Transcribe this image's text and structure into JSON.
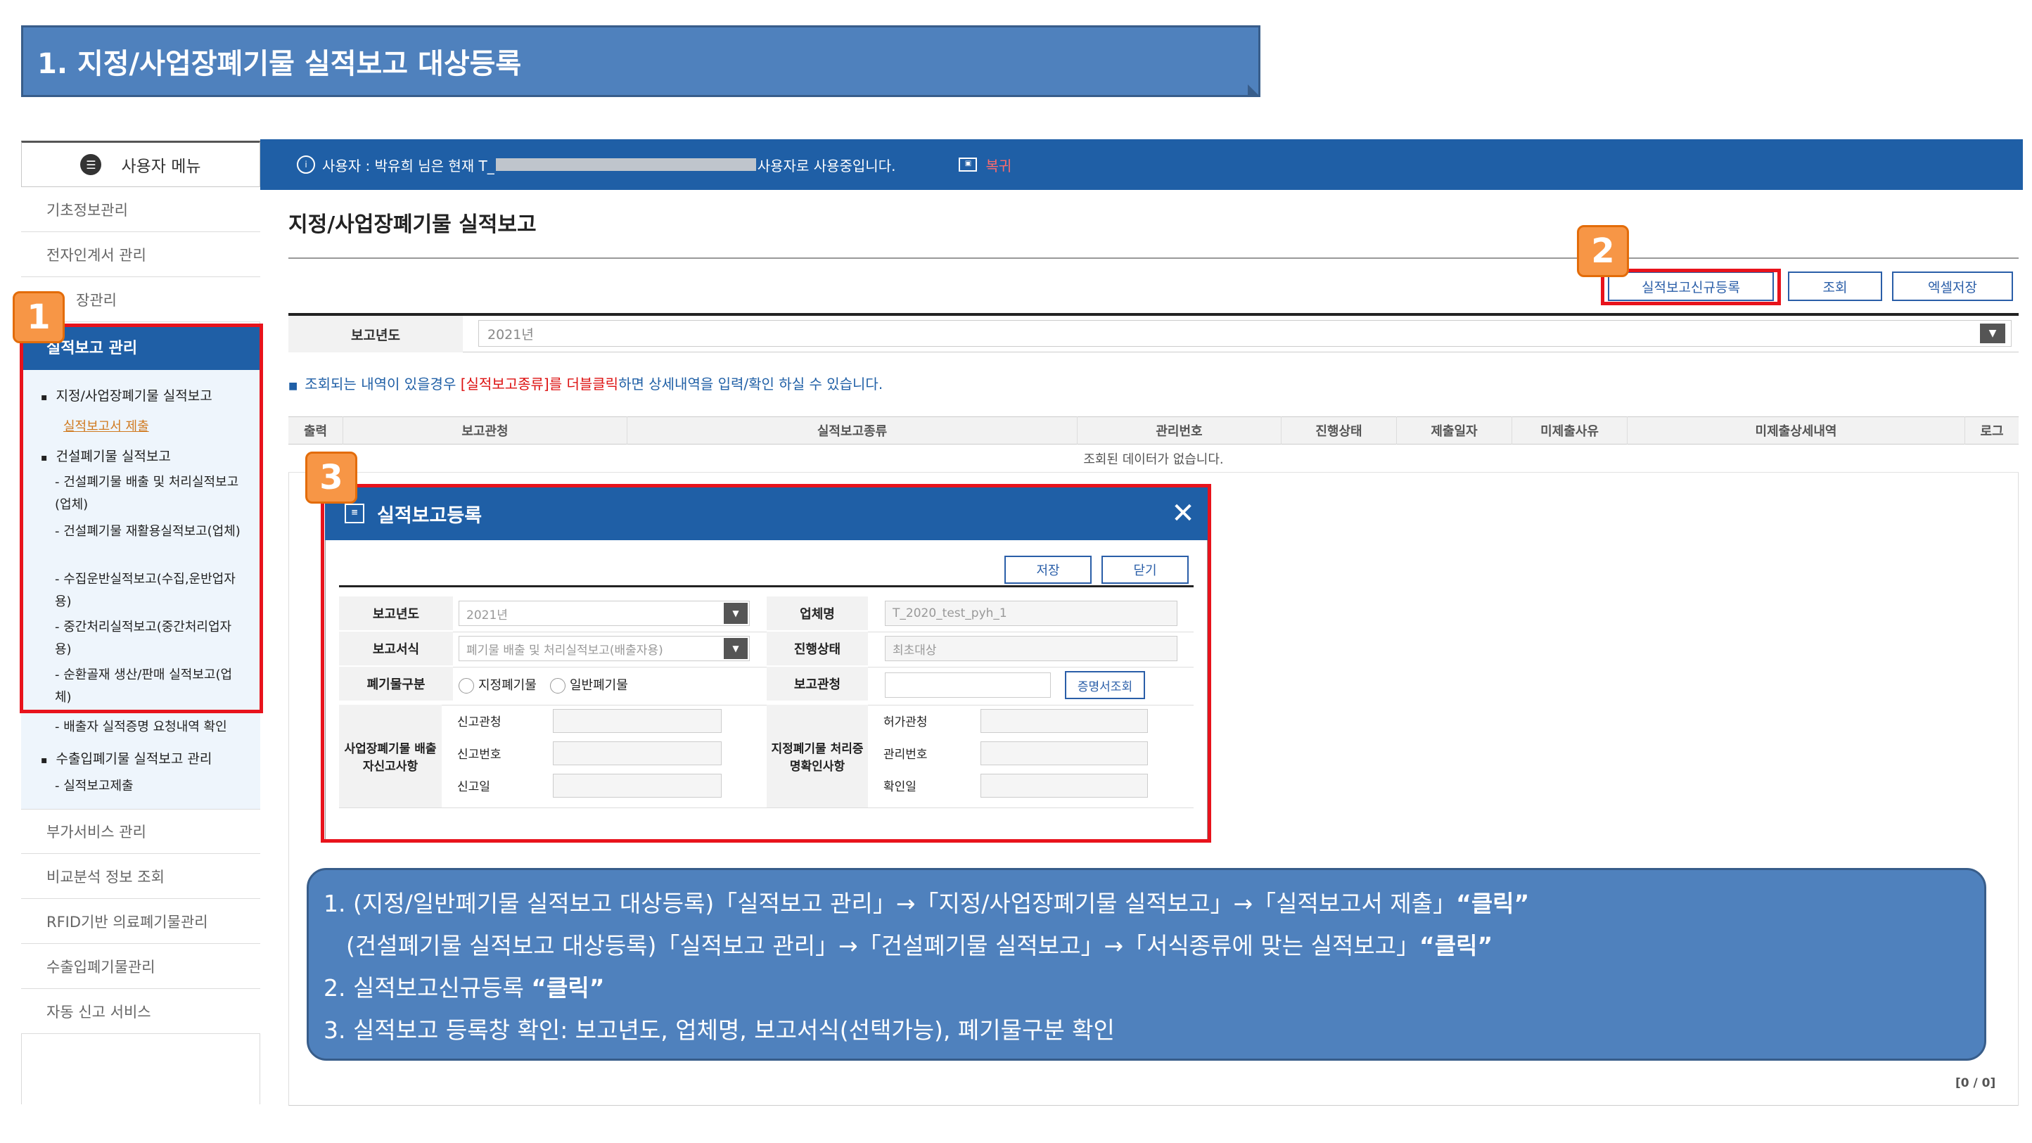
{
  "slide_title": "1. 지정/사업장폐기물 실적보고 대상등록",
  "topbar": {
    "user_prefix": "사용자 : 박유희 님은 현재 T_",
    "user_suffix": "사용자로 사용중입니다.",
    "restore_label": "복귀"
  },
  "sidebar": {
    "header": "사용자 메뉴",
    "items_top": [
      "기초정보관리",
      "전자인계서 관리",
      "장관리"
    ],
    "active": "실적보고 관리",
    "sub": {
      "designated": "지정/사업장폐기물 실적보고",
      "submit_link": "실적보고서 제출",
      "construction": "건설폐기물 실적보고",
      "c1": "- 건설폐기물 배출 및 처리실적보고(업체)",
      "c2": "- 건설폐기물 재활용실적보고(업체)",
      "c3": "- 수집운반실적보고(수집,운반업자용)",
      "c4": "- 중간처리실적보고(중간처리업자용)",
      "c5": "- 순환골재 생산/판매 실적보고(업체)",
      "c6": "- 배출자 실적증명 요청내역 확인",
      "import": "수출입폐기물 실적보고 관리",
      "i1": "- 실적보고제출"
    },
    "items_bottom": [
      "부가서비스 관리",
      "비교분석 정보 조회",
      "RFID기반 의료폐기물관리",
      "수출입폐기물관리",
      "자동 신고 서비스"
    ]
  },
  "main": {
    "title": "지정/사업장폐기물 실적보고",
    "buttons": {
      "new": "실적보고신규등록",
      "search": "조회",
      "excel": "엑셀저장"
    },
    "search_label": "보고년도",
    "year_value": "2021년",
    "notice_a": "조회되는 내역이 있을경우 ",
    "notice_red": "[실적보고종류]를 더블클릭",
    "notice_b": "하면 상세내역을 입력/확인 하실 수 있습니다.",
    "grid_headers": [
      "출력",
      "보고관청",
      "실적보고종류",
      "관리번호",
      "진행상태",
      "제출일자",
      "미제출사유",
      "미제출상세내역",
      "로그"
    ],
    "grid_empty": "조회된 데이터가 없습니다.",
    "pager": "[0 / 0]"
  },
  "modal": {
    "title": "실적보고등록",
    "save": "저장",
    "close": "닫기",
    "labels": {
      "year": "보고년도",
      "company": "업체명",
      "form": "보고서식",
      "status": "진행상태",
      "waste_type": "폐기물구분",
      "office": "보고관청",
      "emitter": "사업장폐기물 배출자신고사항",
      "handler": "지정폐기물 처리증명확인사항"
    },
    "year_value": "2021년",
    "company_value": "T_2020_test_pyh_1",
    "form_value": "폐기물 배출 및 처리실적보고(배출자용)",
    "status_value": "최초대상",
    "radio_designated": "지정폐기물",
    "radio_general": "일반폐기물",
    "cert_button": "증명서조회",
    "emitter_fields": [
      "신고관청",
      "신고번호",
      "신고일"
    ],
    "handler_fields": [
      "허가관청",
      "관리번호",
      "확인일"
    ]
  },
  "badges": [
    "1",
    "2",
    "3"
  ],
  "callout": {
    "line1_a": "1. (지정/일반폐기물 실적보고 대상등록)「실적보고 관리」→「지정/사업장폐기물 실적보고」→「실적보고서 제출」",
    "line1_b": "“클릭”",
    "line2_a": "(건설폐기물 실적보고 대상등록)「실적보고 관리」→「건설폐기물 실적보고」→「서식종류에 맞는 실적보고」",
    "line2_b": "“클릭”",
    "line3_a": "2. 실적보고신규등록 ",
    "line3_b": "“클릭”",
    "line4": "3. 실적보고 등록창 확인: 보고년도, 업체명, 보고서식(선택가능), 폐기물구분 확인"
  },
  "colors": {
    "accent": "#1f5fa6",
    "highlight": "#e8131c",
    "badge": "#f79646",
    "callout": "#4f81bd"
  }
}
